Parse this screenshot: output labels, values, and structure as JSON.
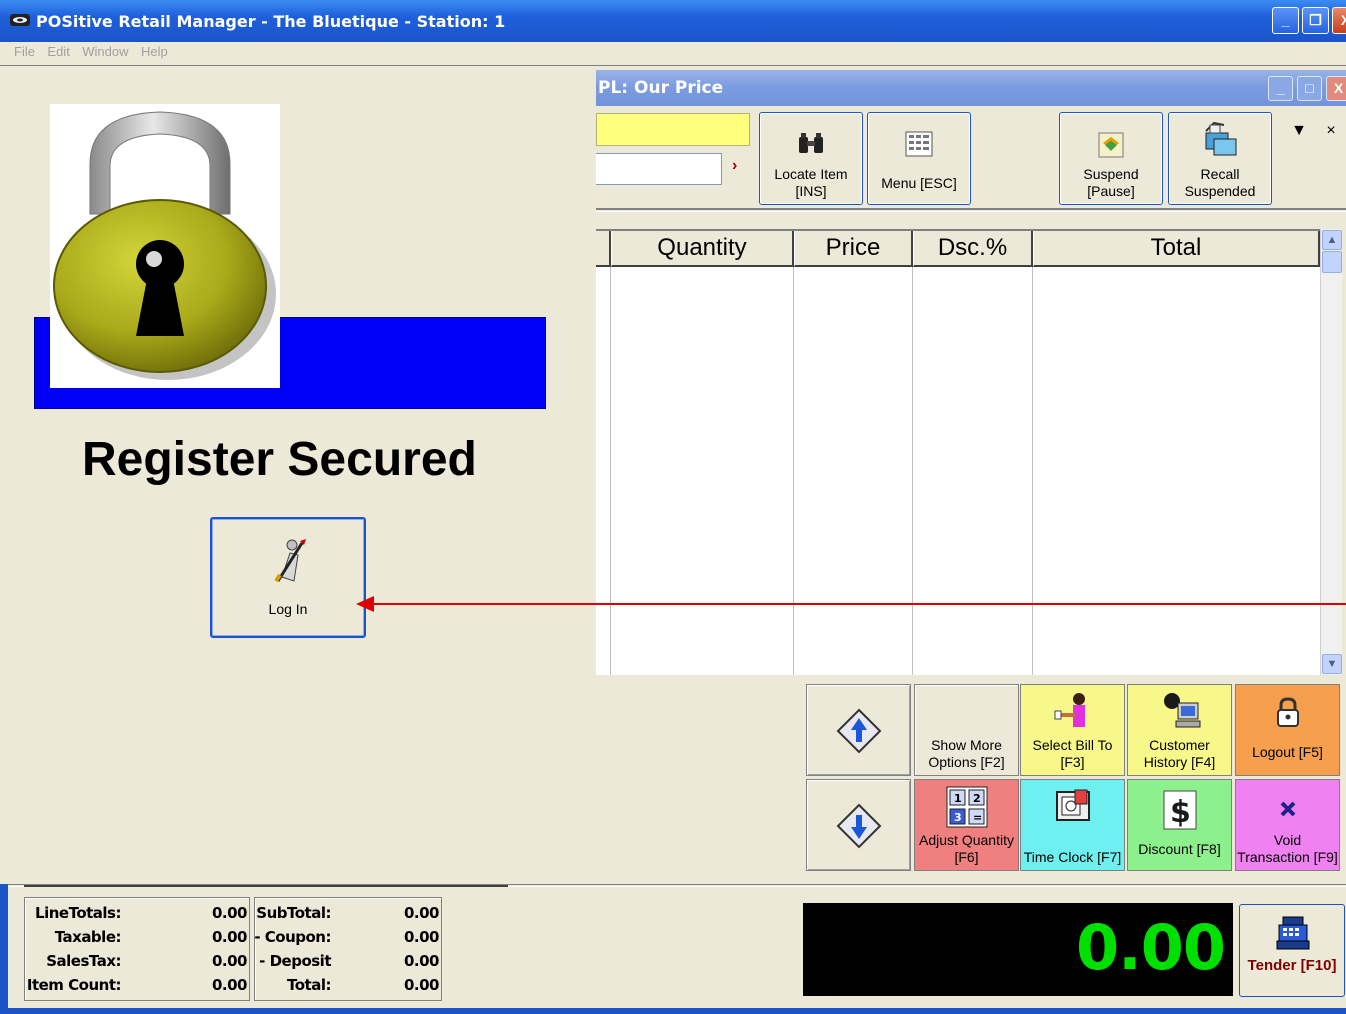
{
  "window": {
    "title": "POSitive Retail Manager - The Bluetique - Station: 1",
    "controls": [
      "_",
      "❐",
      "X"
    ]
  },
  "menubar": [
    "File",
    "Edit",
    "Window",
    "Help"
  ],
  "lock_panel": {
    "heading": "Register Secured",
    "login_label": "Log In"
  },
  "sale_window": {
    "title": "PL: Our Price",
    "toolbar": {
      "locate_label": "Locate Item [INS]",
      "menu_label": "Menu [ESC]",
      "suspend_label": "Suspend [Pause]",
      "recall_label": "Recall Suspended",
      "dropdown_glyph": "▼",
      "close_glyph": "×"
    },
    "grid_headers": [
      "Quantity",
      "Price",
      "Dsc.%",
      "Total"
    ]
  },
  "function_buttons": {
    "show_more": "Show More Options [F2]",
    "select_bill_to": "Select Bill To [F3]",
    "customer_history": "Customer History [F4]",
    "logout": "Logout [F5]",
    "adjust_quantity": "Adjust Quantity [F6]",
    "time_clock": "Time Clock [F7]",
    "discount": "Discount [F8]",
    "void_transaction": "Void Transaction [F9]"
  },
  "totals": {
    "left": [
      {
        "label": "LineTotals:",
        "value": "0.00"
      },
      {
        "label": "Taxable:",
        "value": "0.00"
      },
      {
        "label": "SalesTax:",
        "value": "0.00"
      },
      {
        "label": "Item Count:",
        "value": "0.00"
      }
    ],
    "right": [
      {
        "label": "SubTotal:",
        "value": "0.00"
      },
      {
        "label": "- Coupon:",
        "value": "0.00"
      },
      {
        "label": "- Deposit",
        "value": "0.00"
      },
      {
        "label": "Total:",
        "value": "0.00"
      }
    ]
  },
  "display_amount": "0.00",
  "tender_label": "Tender [F10]",
  "colors": {
    "title_blue": "#1f5fdb",
    "yellow_btn": "#f8f88a",
    "orange_btn": "#f6a04d",
    "red_btn": "#f07f7f",
    "cyan_btn": "#6ff0f0",
    "green_btn": "#8cf18c",
    "magenta_btn": "#f081f0",
    "display_green": "#00e000",
    "annotation_red": "#e00000"
  }
}
